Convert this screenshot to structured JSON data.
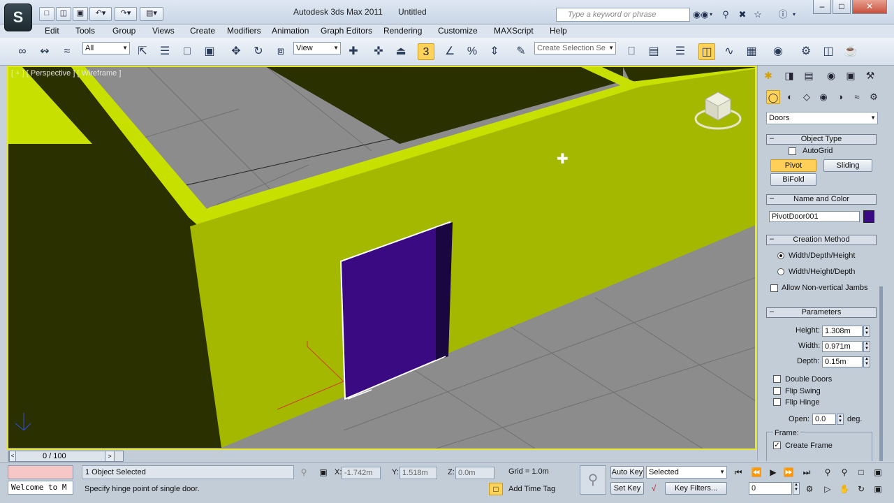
{
  "app": {
    "logo": "S",
    "title": "Autodesk 3ds Max  2011",
    "document": "Untitled",
    "search_placeholder": "Type a keyword or phrase"
  },
  "quick_access": [
    "new-icon",
    "open-icon",
    "save-icon",
    "undo-icon",
    "redo-icon",
    "project-icon"
  ],
  "window_controls": {
    "minimize": "–",
    "maximize": "□",
    "close": "✕"
  },
  "menu": [
    "Edit",
    "Tools",
    "Group",
    "Views",
    "Create",
    "Modifiers",
    "Animation",
    "Graph Editors",
    "Rendering",
    "Customize",
    "MAXScript",
    "Help"
  ],
  "toolbar": {
    "selection_filter": "All",
    "reference_coord": "View",
    "snap_value": "3",
    "named_selection": "Create Selection Se"
  },
  "viewport": {
    "label": "[ + ] [ Perspective ] [ Wireframe ]",
    "colors": {
      "wall": "#a4b800",
      "wall_top": "#c8e000",
      "wall_dark": "#2b3000",
      "door": "#3a0a82",
      "floor": "#8c8c8c"
    }
  },
  "command_panel": {
    "category": "Doors",
    "object_type": {
      "title": "Object Type",
      "autogrid": "AutoGrid",
      "buttons": [
        "Pivot",
        "Sliding",
        "BiFold"
      ],
      "active": "Pivot"
    },
    "name_color": {
      "title": "Name and Color",
      "name": "PivotDoor001",
      "color": "#3a0a82"
    },
    "creation_method": {
      "title": "Creation Method",
      "options": [
        "Width/Depth/Height",
        "Width/Height/Depth"
      ],
      "selected": "Width/Depth/Height",
      "allow_non_vertical": "Allow Non-vertical Jambs"
    },
    "parameters": {
      "title": "Parameters",
      "height_label": "Height:",
      "height": "1.308m",
      "width_label": "Width:",
      "width": "0.971m",
      "depth_label": "Depth:",
      "depth": "0.15m",
      "double_doors": "Double Doors",
      "flip_swing": "Flip Swing",
      "flip_hinge": "Flip Hinge",
      "open_label": "Open:",
      "open": "0.0",
      "open_unit": "deg.",
      "frame_label": "Frame:",
      "create_frame": "Create Frame"
    }
  },
  "timeline": {
    "frame": "0 / 100"
  },
  "status": {
    "maxscript": "Welcome to M",
    "selection": "1 Object Selected",
    "prompt": "Specify hinge point of single door.",
    "x_label": "X:",
    "x": "-1.742m",
    "y_label": "Y:",
    "y": "1.518m",
    "z_label": "Z:",
    "z": "0.0m",
    "grid": "Grid = 1.0m",
    "add_time_tag": "Add Time Tag",
    "auto_key": "Auto Key",
    "set_key": "Set Key",
    "key_mode": "Selected",
    "key_filters": "Key Filters...",
    "current_frame": "0"
  }
}
